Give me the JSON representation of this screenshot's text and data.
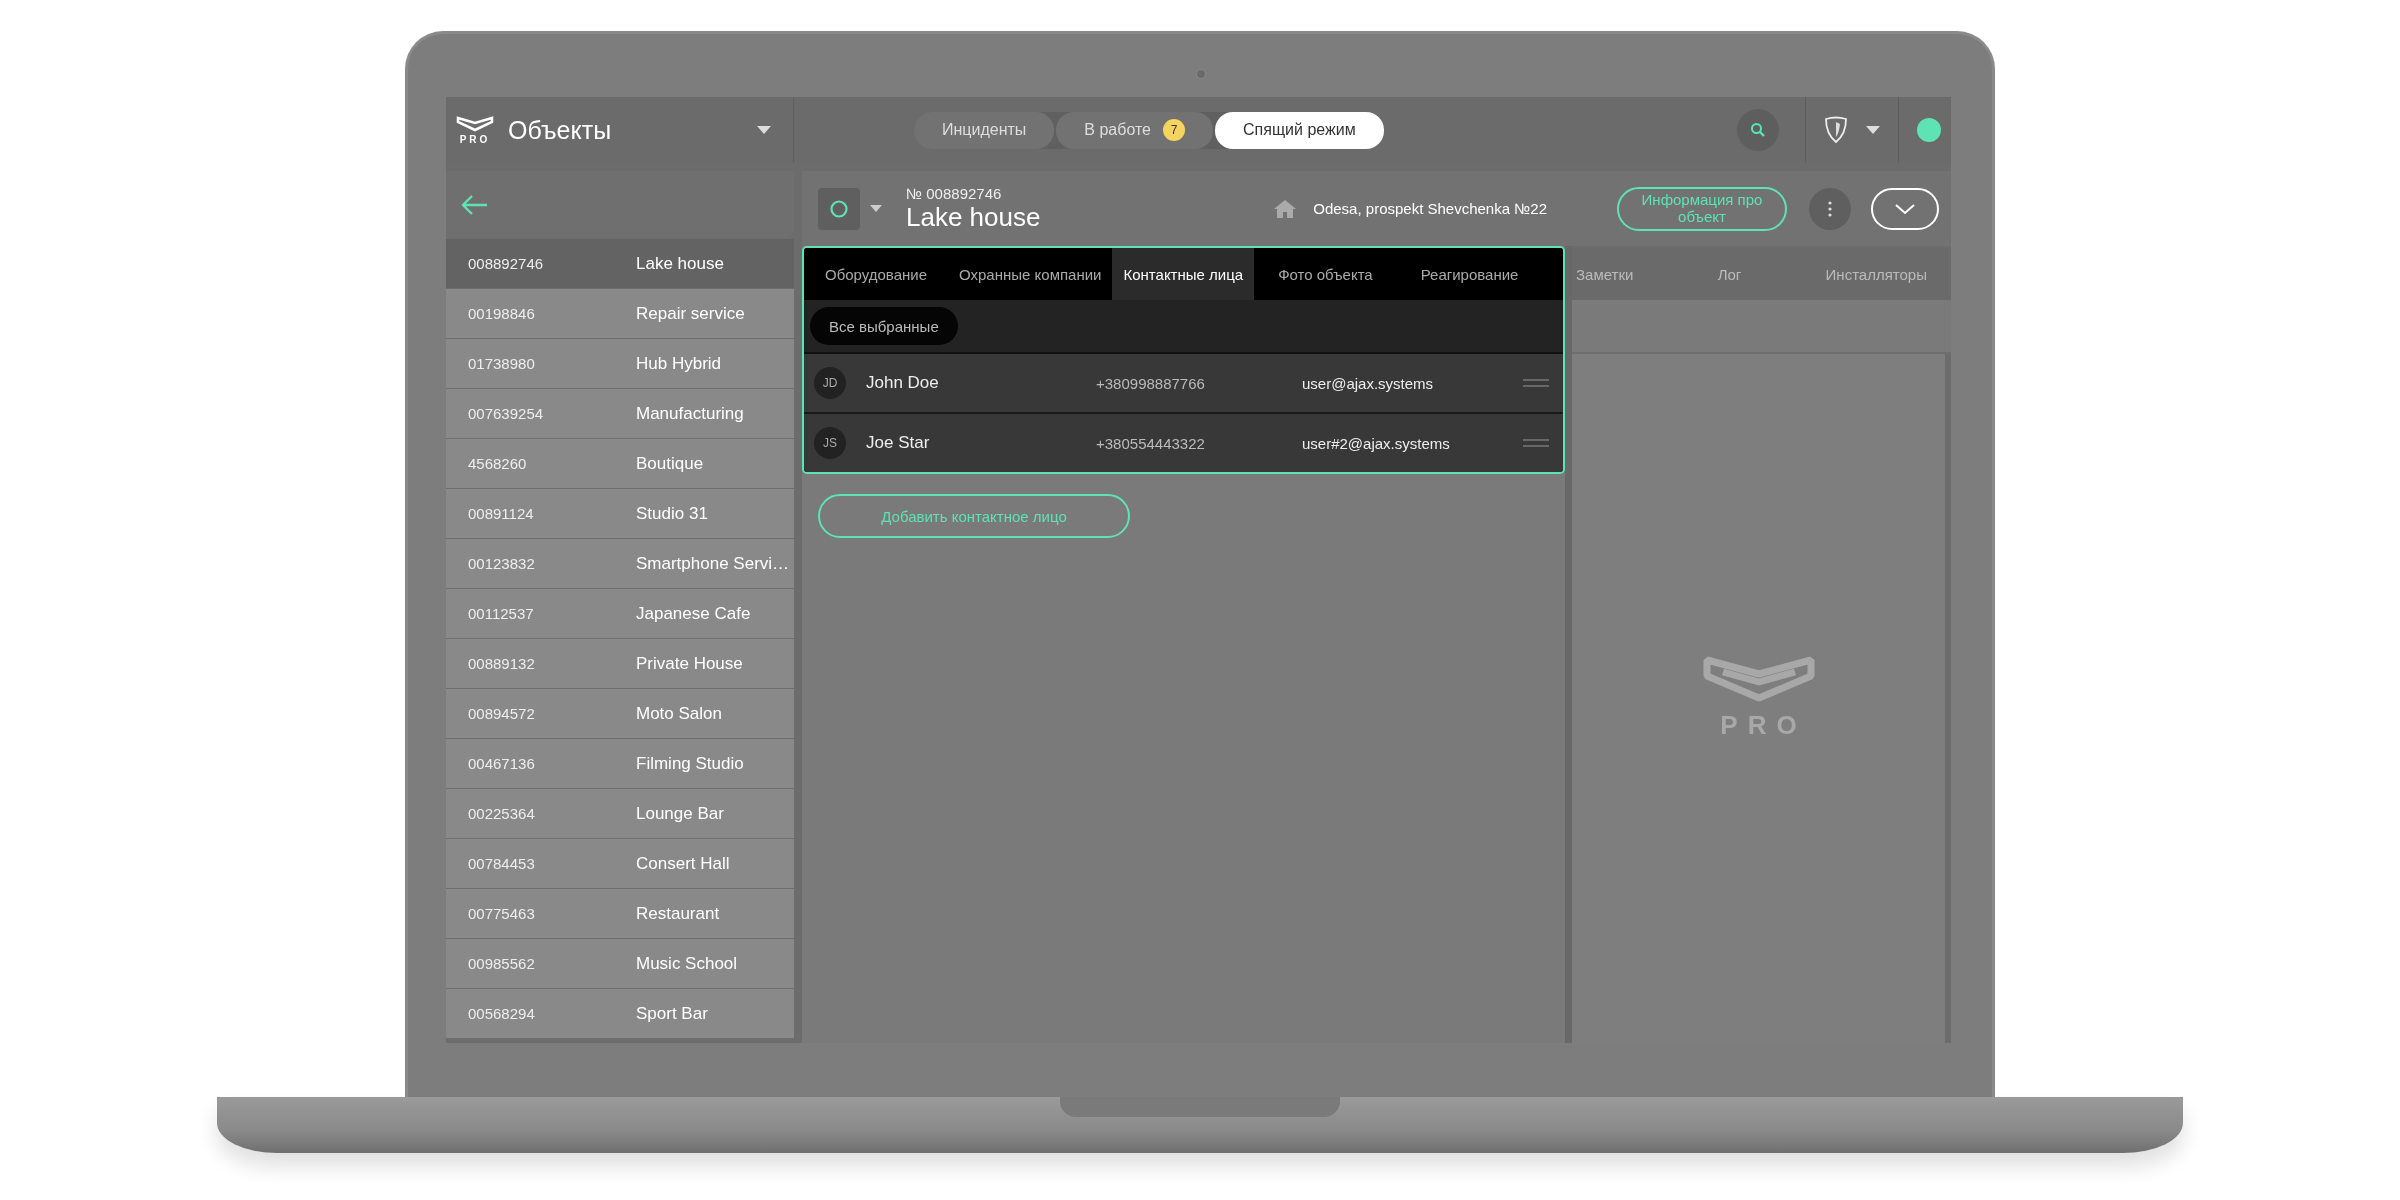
{
  "app_bar": {
    "logo_text": "PRO",
    "title": "Объекты",
    "segments": [
      {
        "label": "Инциденты",
        "selected": false
      },
      {
        "label": "В работе",
        "selected": false,
        "badge": "7"
      },
      {
        "label": "Спящий режим",
        "selected": true
      }
    ]
  },
  "sidebar": {
    "objects": [
      {
        "number": "008892746",
        "name": "Lake house",
        "selected": true
      },
      {
        "number": "00198846",
        "name": "Repair service",
        "selected": false
      },
      {
        "number": "01738980",
        "name": "Hub Hybrid",
        "selected": false
      },
      {
        "number": "007639254",
        "name": "Manufacturing",
        "selected": false
      },
      {
        "number": "4568260",
        "name": "Boutique",
        "selected": false
      },
      {
        "number": "00891124",
        "name": "Studio 31",
        "selected": false
      },
      {
        "number": "00123832",
        "name": "Smartphone Servi…",
        "selected": false
      },
      {
        "number": "00112537",
        "name": "Japanese Cafe",
        "selected": false
      },
      {
        "number": "00889132",
        "name": "Private House",
        "selected": false
      },
      {
        "number": "00894572",
        "name": "Moto Salon",
        "selected": false
      },
      {
        "number": "00467136",
        "name": "Filming Studio",
        "selected": false
      },
      {
        "number": "00225364",
        "name": "Lounge Bar",
        "selected": false
      },
      {
        "number": "00784453",
        "name": "Consert Hall",
        "selected": false
      },
      {
        "number": "00775463",
        "name": "Restaurant",
        "selected": false
      },
      {
        "number": "00985562",
        "name": "Music School",
        "selected": false
      },
      {
        "number": "00568294",
        "name": "Sport Bar",
        "selected": false
      }
    ]
  },
  "object_header": {
    "number_prefix": "№",
    "number": "008892746",
    "name": "Lake house",
    "address": "Odesa, prospekt Shevchenka №22",
    "info_button": "Информация про объект"
  },
  "tabs": [
    {
      "label": "Оборудование",
      "selected": false,
      "highlighted": true
    },
    {
      "label": "Охранные компании",
      "selected": false,
      "highlighted": true
    },
    {
      "label": "Контактные лица",
      "selected": true,
      "highlighted": true
    },
    {
      "label": "Фото объекта",
      "selected": false,
      "highlighted": true
    },
    {
      "label": "Реагирование",
      "selected": false,
      "highlighted": true
    },
    {
      "label": "Заметки",
      "selected": false,
      "highlighted": false
    },
    {
      "label": "Лог",
      "selected": false,
      "highlighted": false
    },
    {
      "label": "Инсталляторы",
      "selected": false,
      "highlighted": false
    }
  ],
  "filter": {
    "label": "Все выбранные"
  },
  "contacts": [
    {
      "initials": "JD",
      "name": "John Doe",
      "phone": "+380998887766",
      "email": "user@ajax.systems"
    },
    {
      "initials": "JS",
      "name": "Joe Star",
      "phone": "+380554443322",
      "email": "user#2@ajax.systems"
    }
  ],
  "add_button": "Добавить контактное лицо",
  "side_panel": {
    "logo_text": "PRO"
  }
}
